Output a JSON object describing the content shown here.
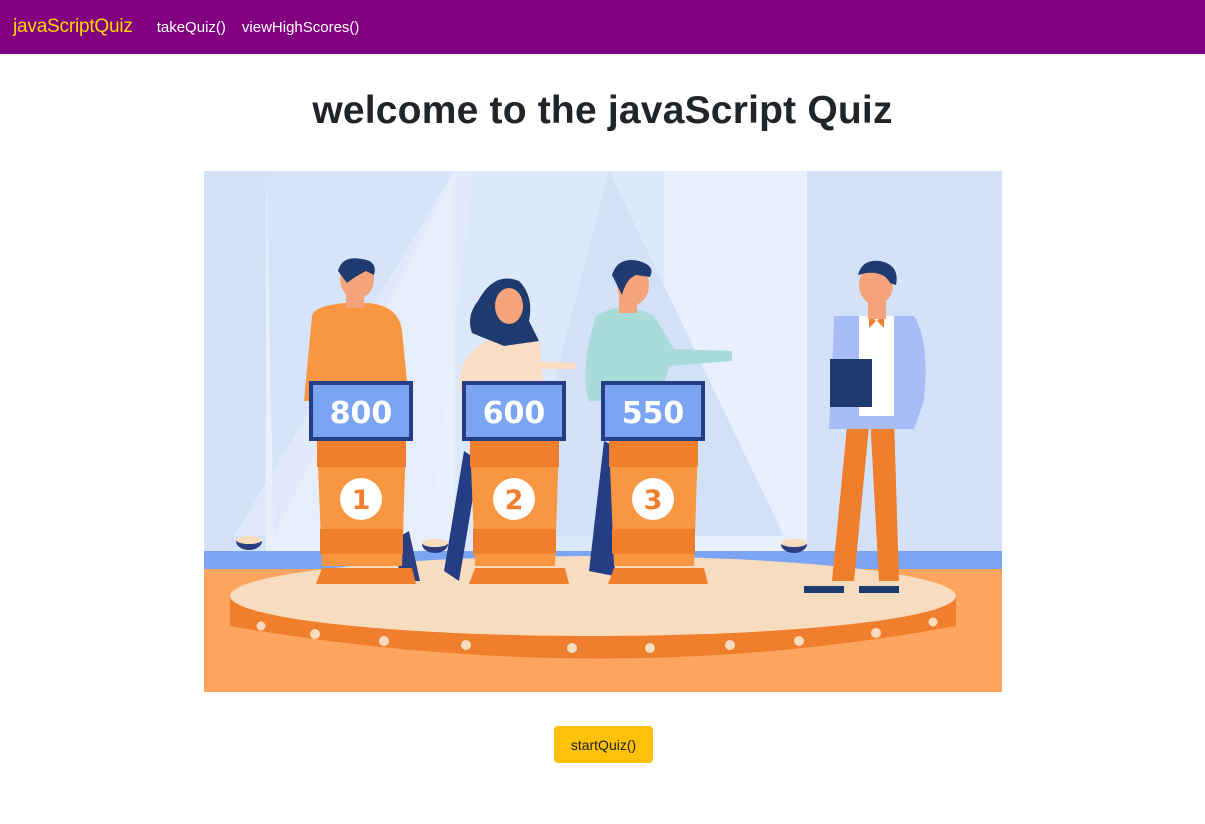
{
  "nav": {
    "brand": "javaScriptQuiz",
    "take_quiz": "takeQuiz()",
    "view_high_scores": "viewHighScores()"
  },
  "main": {
    "title": "welcome to the javaScript Quiz",
    "start_button": "startQuiz()"
  },
  "illustration": {
    "podiums": [
      {
        "score": "800",
        "number": "1"
      },
      {
        "score": "600",
        "number": "2"
      },
      {
        "score": "550",
        "number": "3"
      }
    ]
  },
  "colors": {
    "navbar": "#800080",
    "brand": "#ffd700",
    "button": "#ffc107"
  }
}
